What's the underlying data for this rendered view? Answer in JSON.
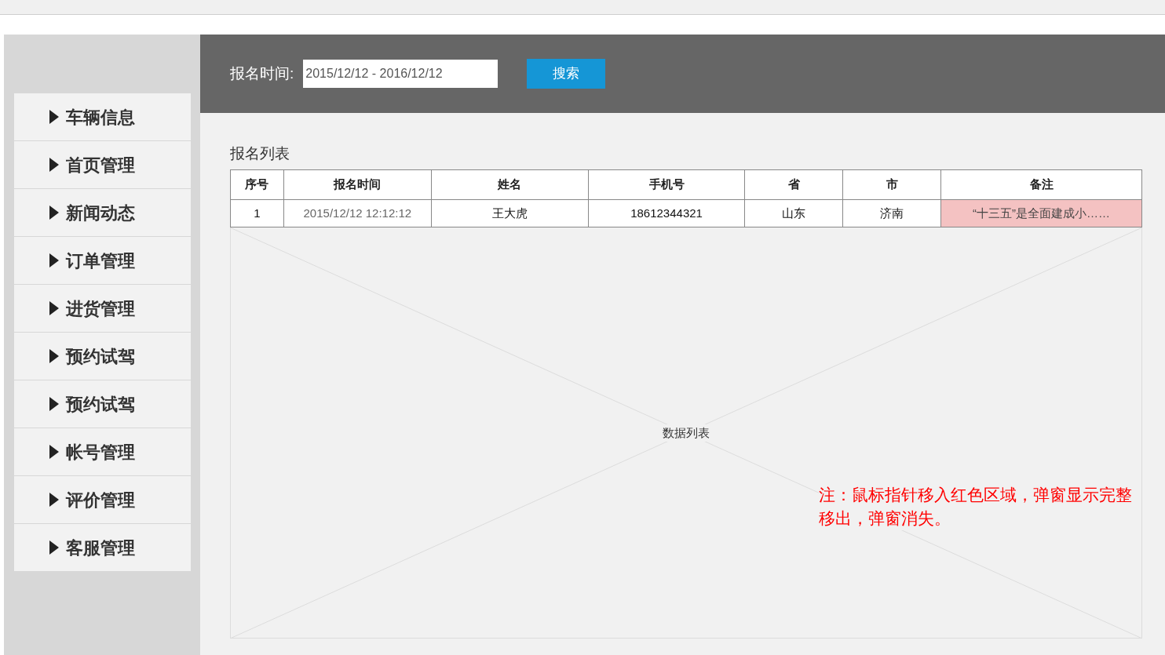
{
  "sidebar": {
    "items": [
      {
        "label": "车辆信息"
      },
      {
        "label": "首页管理"
      },
      {
        "label": "新闻动态"
      },
      {
        "label": "订单管理"
      },
      {
        "label": "进货管理"
      },
      {
        "label": "预约试驾"
      },
      {
        "label": "预约试驾"
      },
      {
        "label": "帐号管理"
      },
      {
        "label": "评价管理"
      },
      {
        "label": "客服管理"
      }
    ]
  },
  "filter": {
    "label": "报名时间:",
    "date_range": "2015/12/12 - 2016/12/12",
    "button": "搜索"
  },
  "list_title": "报名列表",
  "table": {
    "columns": [
      "序号",
      "报名时间",
      "姓名",
      "手机号",
      "省",
      "市",
      "备注"
    ],
    "rows": [
      {
        "cells": [
          {
            "text": "1",
            "highlighted": false
          },
          {
            "text": "2015/12/12 12:12:12",
            "highlighted": false
          },
          {
            "text": "王大虎",
            "highlighted": false
          },
          {
            "text": "18612344321",
            "highlighted": false
          },
          {
            "text": "山东",
            "highlighted": false
          },
          {
            "text": "济南",
            "highlighted": false
          },
          {
            "text": "“十三五”是全面建成小……",
            "highlighted": true
          }
        ]
      }
    ]
  },
  "placeholder_label": "数据列表",
  "note": [
    "注：鼠标指针移入红色区域，弹窗显示完整",
    "移出，弹窗消失。"
  ]
}
